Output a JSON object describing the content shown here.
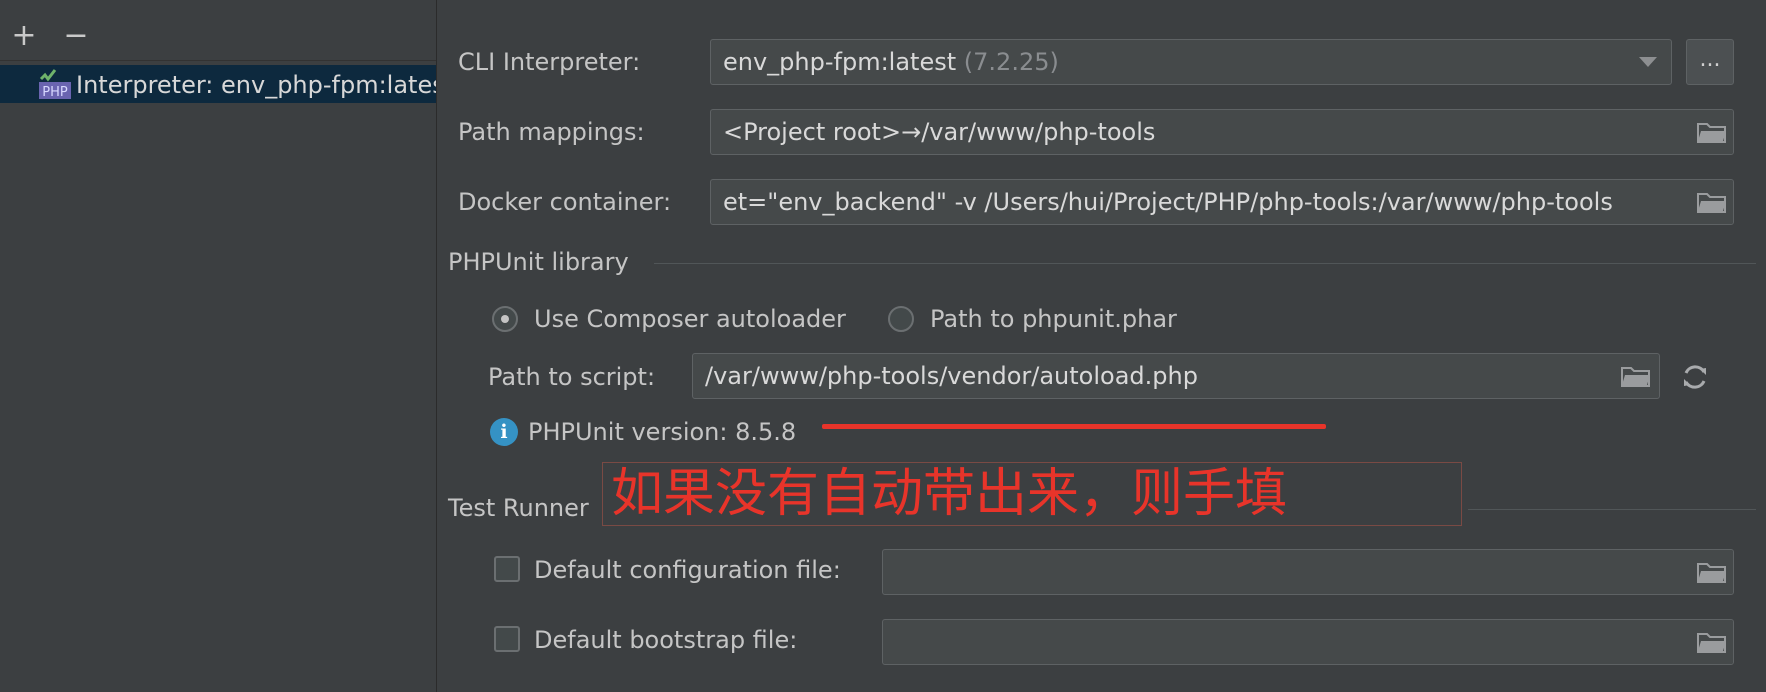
{
  "toolbar": {
    "add_symbol": "+",
    "remove_symbol": "−"
  },
  "tree": {
    "selected_item_label": "Interpreter: env_php-fpm:latest",
    "icon_text": "PHP"
  },
  "form": {
    "cli_interpreter": {
      "label": "CLI Interpreter:",
      "value": "env_php-fpm:latest",
      "version": "(7.2.25)",
      "more_button": "..."
    },
    "path_mappings": {
      "label": "Path mappings:",
      "value": "<Project root>→/var/www/php-tools"
    },
    "docker_container": {
      "label": "Docker container:",
      "value": "et=\"env_backend\" -v /Users/hui/Project/PHP/php-tools:/var/www/php-tools"
    }
  },
  "phpunit": {
    "section_title": "PHPUnit library",
    "options": [
      {
        "label": "Use Composer autoloader",
        "selected": true
      },
      {
        "label": "Path to phpunit.phar",
        "selected": false
      }
    ],
    "path_to_script_label": "Path to script:",
    "path_to_script_value": "/var/www/php-tools/vendor/autoload.php",
    "version_text": "PHPUnit version: 8.5.8",
    "info_icon_glyph": "i"
  },
  "annotation": {
    "text": "如果没有自动带出来，则手填",
    "color": "#e8342a"
  },
  "test_runner": {
    "section_title": "Test Runner",
    "default_config_label": "Default configuration file:",
    "default_config_value": "",
    "default_bootstrap_label": "Default bootstrap file:",
    "default_bootstrap_value": ""
  },
  "colors": {
    "background": "#3c3f41",
    "field": "#45494a",
    "selection": "#0d293e",
    "info": "#3592c4",
    "annotation": "#e8342a"
  },
  "icons": [
    "add-icon",
    "remove-icon",
    "php-interpreter-icon",
    "dropdown-arrow-icon",
    "folder-icon",
    "refresh-icon",
    "info-icon"
  ]
}
